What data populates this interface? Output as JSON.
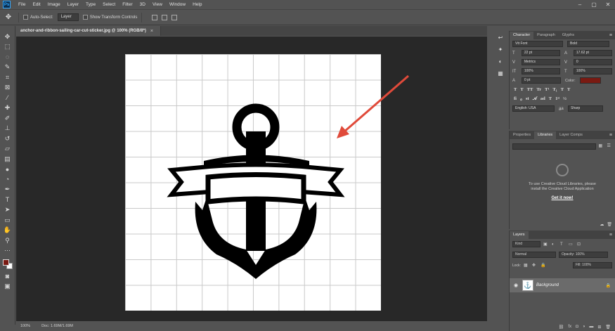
{
  "app": {
    "logo": "Ps",
    "menu": [
      "File",
      "Edit",
      "Image",
      "Layer",
      "Type",
      "Select",
      "Filter",
      "3D",
      "View",
      "Window",
      "Help"
    ],
    "window_controls": [
      "–",
      "▢",
      "✕"
    ]
  },
  "options": {
    "auto_select_label": "Auto-Select:",
    "auto_select_value": "Layer",
    "transform_controls_label": "Show Transform Controls"
  },
  "document": {
    "tab_title": "anchor-and-ribbon-sailing-car-cut-sticker.jpg @ 100% (RGB/8*)",
    "close": "×"
  },
  "status": {
    "zoom": "100%",
    "doc_size": "Doc: 1.69M/1.69M"
  },
  "character_panel": {
    "tabs": [
      "Character",
      "Paragraph",
      "Glyphs"
    ],
    "font_family": "Vtt Font",
    "font_style": "Bold",
    "font_size": "22 pt",
    "leading": "17.62 pt",
    "kerning": "Metrics",
    "tracking": "0",
    "vertical_scale": "100%",
    "horizontal_scale": "100%",
    "baseline_shift": "0 pt",
    "color_label": "Color:",
    "color": "#7a1a12",
    "glyphs": [
      "T",
      "T",
      "TT",
      "Tr",
      "T¹",
      "T₁",
      "T",
      "T"
    ],
    "language": "English: USA",
    "aa_label": "a̲a",
    "antialias": "Sharp"
  },
  "libraries_panel": {
    "tabs": [
      "Properties",
      "Libraries",
      "Layer Comps"
    ],
    "message": "To use Creative Cloud Libraries, please install the Creative Cloud Application",
    "link": "Get it now!"
  },
  "layers_panel": {
    "tabs": [
      "Layers"
    ],
    "filter_kind": "Kind",
    "blend_mode": "Normal",
    "opacity": "Opacity: 100%",
    "lock_label": "Lock:",
    "fill": "Fill: 100%",
    "layer_name": "Background"
  }
}
